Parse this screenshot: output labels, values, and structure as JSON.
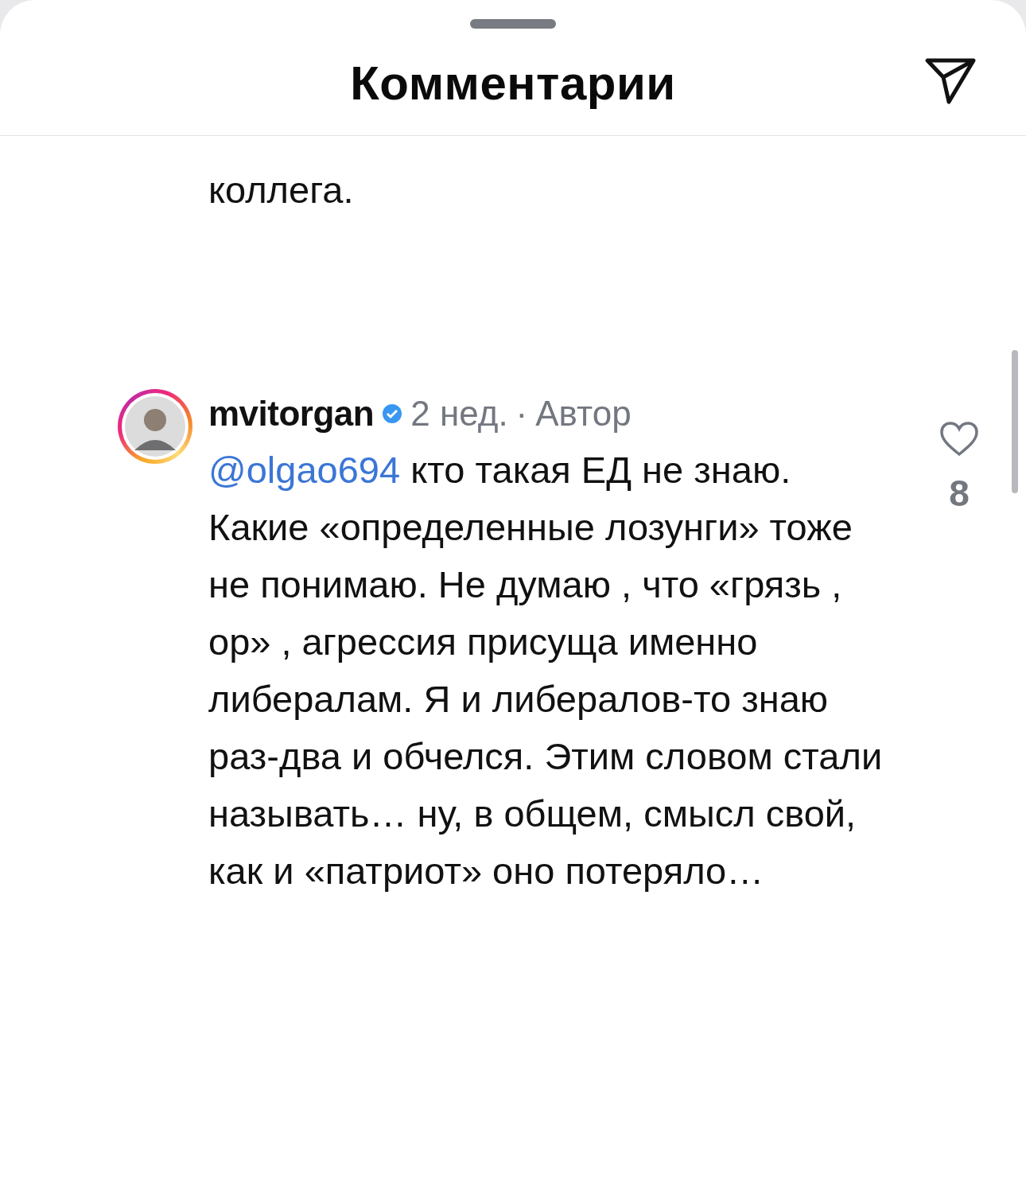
{
  "header": {
    "title": "Комментарии"
  },
  "previous_comment": {
    "text_tail": "коллега."
  },
  "comment": {
    "username": "mvitorgan",
    "verified": true,
    "time": "2 нед.",
    "separator": "·",
    "role": "Автор",
    "mention": "@olgao694",
    "text": "кто такая ЕД не знаю. Какие «определенные лозунги» тоже не понимаю. Не думаю , что «грязь , ор» , агрессия присуща именно либералам. Я и либералов-то знаю раз-два и обчелся. Этим словом стали называть… ну, в общем, смысл свой, как и «патриот» оно потеряло…",
    "like_count": "8",
    "liked": false
  }
}
